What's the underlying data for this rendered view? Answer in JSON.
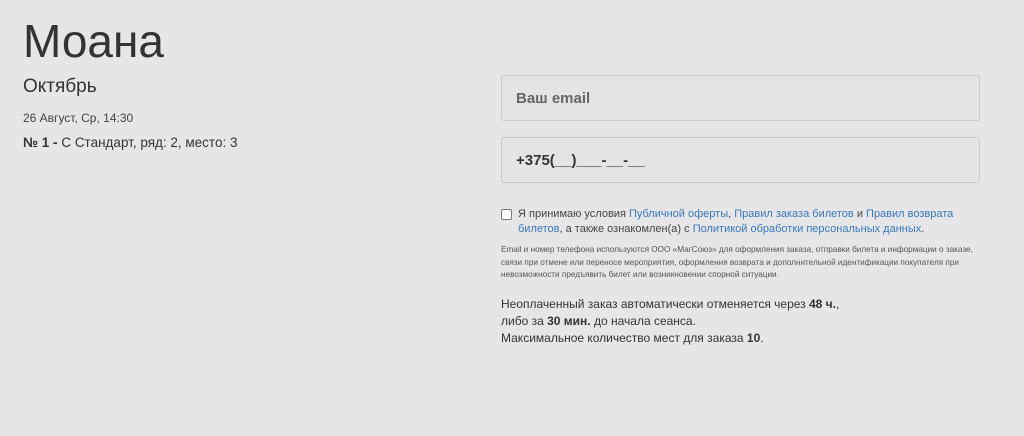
{
  "event": {
    "title": "Моана",
    "month": "Октябрь",
    "datetime": "26 Август, Ср, 14:30",
    "seat_prefix": "№ 1 - ",
    "seat_detail": "С Стандарт, ряд: 2, место: 3"
  },
  "form": {
    "email_placeholder": "Ваш email",
    "phone_value": "+375(__)___-__-__",
    "consent": {
      "checked": false,
      "text_1": "Я принимаю условия ",
      "link_offer": "Публичной оферты",
      "text_2": ", ",
      "link_rules": "Правил заказа билетов",
      "text_3": " и ",
      "link_return": "Правил возврата билетов",
      "text_4": ", а также ознакомлен(а) с ",
      "link_privacy": "Политикой обработки персональных данных",
      "text_5": "."
    },
    "disclaimer": "Email и номер телефона используются ООО «МагСоюз» для оформления заказа, отправки билета и информации о заказе, связи при отмене или переносе мероприятия, оформления возврата и дополнительной идентификации покупателя при невозможности предъявить билет или возникновении спорной ситуации."
  },
  "notice": {
    "line1_text": "Неоплаченный заказ автоматически отменяется через ",
    "line1_bold": "48 ч.",
    "line1_end": ",",
    "line2_text": "либо за ",
    "line2_bold": "30 мин.",
    "line2_end": " до начала сеанса.",
    "line3_text": "Максимальное количество мест для заказа ",
    "line3_bold": "10",
    "line3_end": "."
  }
}
